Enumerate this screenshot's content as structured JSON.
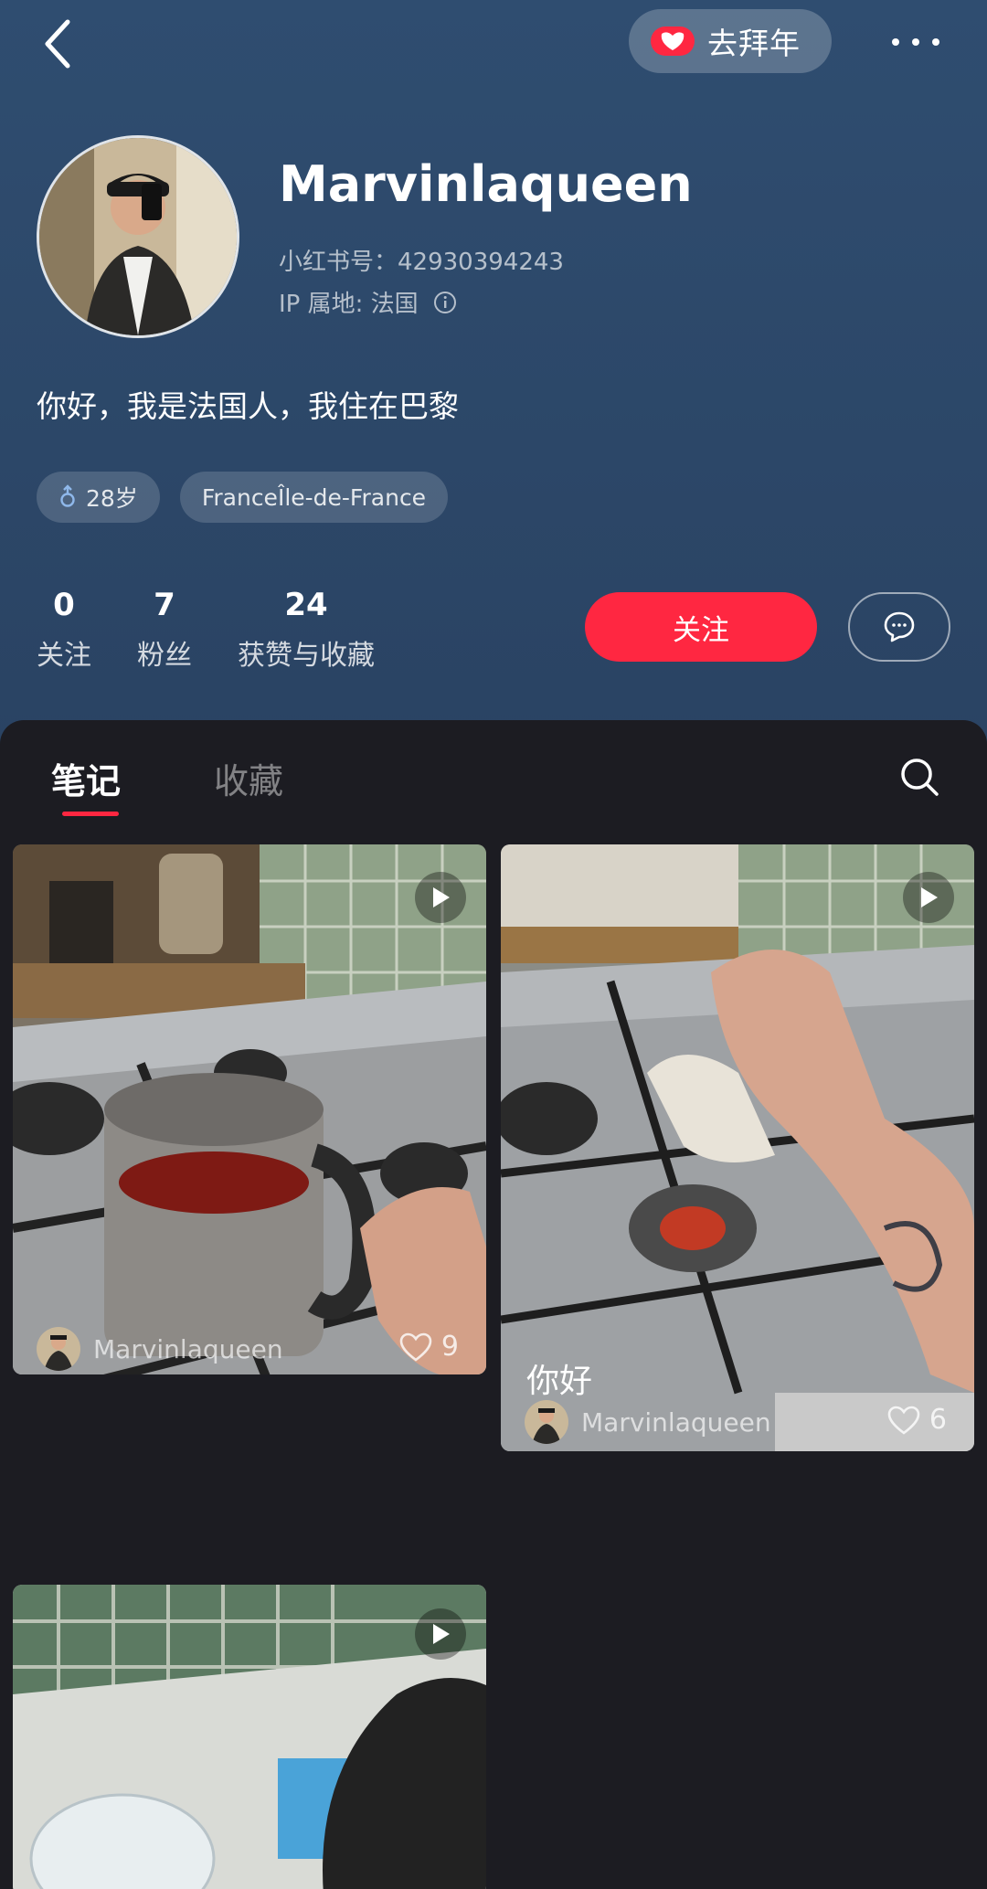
{
  "header": {
    "bainian_label": "去拜年",
    "username": "Marvinlaqueen",
    "redbook_id": "小红书号：42930394243",
    "ip_location": "IP 属地: 法国",
    "bio": "你好，我是法国人，我住在巴黎",
    "tags": [
      {
        "label": "28岁",
        "icon": "male-icon"
      },
      {
        "label": "FranceÎle-de-France"
      }
    ],
    "stats": [
      {
        "value": "0",
        "label": "关注"
      },
      {
        "value": "7",
        "label": "粉丝"
      },
      {
        "value": "24",
        "label": "获赞与收藏"
      }
    ],
    "follow_label": "关注"
  },
  "tabs": [
    {
      "label": "笔记",
      "active": true
    },
    {
      "label": "收藏",
      "active": false
    }
  ],
  "notes": [
    {
      "author": "Marvinlaqueen",
      "likes": "9",
      "title": "",
      "type": "video"
    },
    {
      "author": "Marvinlaqueen",
      "likes": "6",
      "title": "你好",
      "type": "video"
    },
    {
      "author": "",
      "likes": "",
      "title": "",
      "type": "video"
    }
  ],
  "colors": {
    "accent": "#ff2741",
    "header_bg": "#2e4a6c",
    "content_bg": "#1c1c22"
  }
}
